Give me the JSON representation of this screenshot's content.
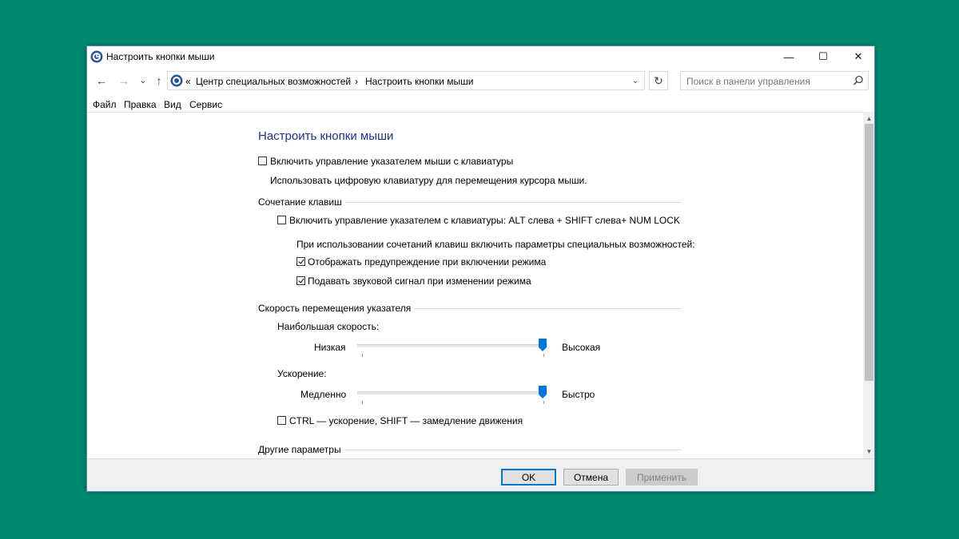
{
  "window": {
    "title": "Настроить кнопки мыши",
    "minimize_glyph": "—",
    "maximize_glyph": "☐",
    "close_glyph": "✕"
  },
  "nav": {
    "back_glyph": "←",
    "forward_glyph": "→",
    "recent_glyph": "⌄",
    "up_glyph": "↑",
    "breadcrumb_prefix": "«",
    "breadcrumb": [
      "Центр специальных возможностей",
      "Настроить кнопки мыши"
    ],
    "breadcrumb_sep": "›",
    "dropdown_glyph": "⌄",
    "refresh_glyph": "↻",
    "search_placeholder": "Поиск в панели управления"
  },
  "menu": [
    "Файл",
    "Правка",
    "Вид",
    "Сервис"
  ],
  "page": {
    "heading": "Настроить кнопки мыши",
    "main_option": {
      "label": "Включить управление указателем мыши с клавиатуры",
      "checked": false,
      "description": "Использовать цифровую клавиатуру для перемещения курсора мыши."
    },
    "shortcut_group": {
      "title": "Сочетание клавиш",
      "toggle_label": "Включить управление указателем с клавиатуры: ALT слева + SHIFT слева+ NUM LOCK",
      "toggle_checked": false,
      "info": "При использовании сочетаний клавиш включить параметры специальных возможностей:",
      "options": [
        {
          "label": "Отображать предупреждение при включении режима",
          "checked": true
        },
        {
          "label": "Подавать звуковой сигнал при изменении режима",
          "checked": true
        }
      ]
    },
    "speed_group": {
      "title": "Скорость перемещения указателя",
      "top_speed": {
        "label": "Наибольшая скорость:",
        "min_label": "Низкая",
        "max_label": "Высокая",
        "value": 1.0
      },
      "acceleration": {
        "label": "Ускорение:",
        "min_label": "Медленно",
        "max_label": "Быстро",
        "value": 1.0
      },
      "modifier_option": {
        "label": "CTRL — ускорение, SHIFT — замедление движения",
        "checked": false
      }
    },
    "other_group": {
      "title": "Другие параметры"
    }
  },
  "buttons": {
    "ok": "OK",
    "cancel": "Отмена",
    "apply": "Применить"
  },
  "colors": {
    "background": "#00896f",
    "heading": "#1e3287",
    "slider_thumb": "#0078d7",
    "badge": "#1fb141"
  }
}
